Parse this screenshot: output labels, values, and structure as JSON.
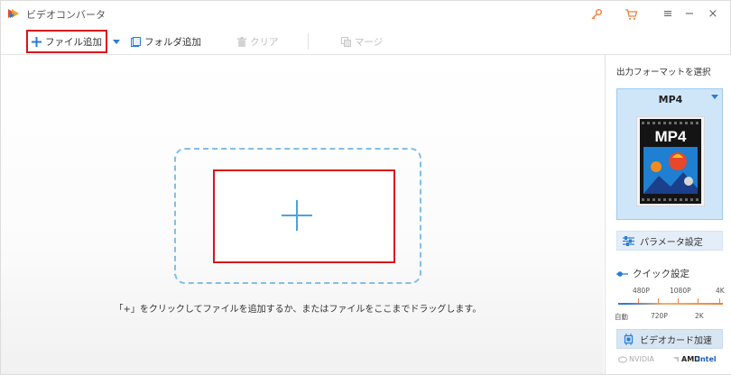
{
  "titlebar": {
    "title": "ビデオコンバータ",
    "icons": [
      "app-logo-icon",
      "key-icon",
      "cart-icon",
      "menu-icon",
      "minimize-icon",
      "close-icon"
    ]
  },
  "toolbar": {
    "add_file": "ファイル追加",
    "add_folder": "フォルダ追加",
    "clear": "クリア",
    "merge": "マージ"
  },
  "main": {
    "hint": "「+」をクリックしてファイルを追加するか、またはファイルをここまでドラッグします。"
  },
  "panel": {
    "output_label": "出力フォーマットを選択",
    "format": "MP4",
    "format_icon_text": "MP4",
    "param_button": "パラメータ設定",
    "quick_label": "クイック設定",
    "quality_top": [
      "480P",
      "1080P",
      "4K"
    ],
    "quality_bottom": [
      "自動",
      "720P",
      "2K"
    ],
    "gpu_button": "ビデオカード加速",
    "vendors": [
      "NVIDIA",
      "AMD",
      "Intel"
    ]
  },
  "colors": {
    "accent": "#2b7bd6",
    "highlight": "#d9141b",
    "format_card": "#cfe6f9"
  }
}
